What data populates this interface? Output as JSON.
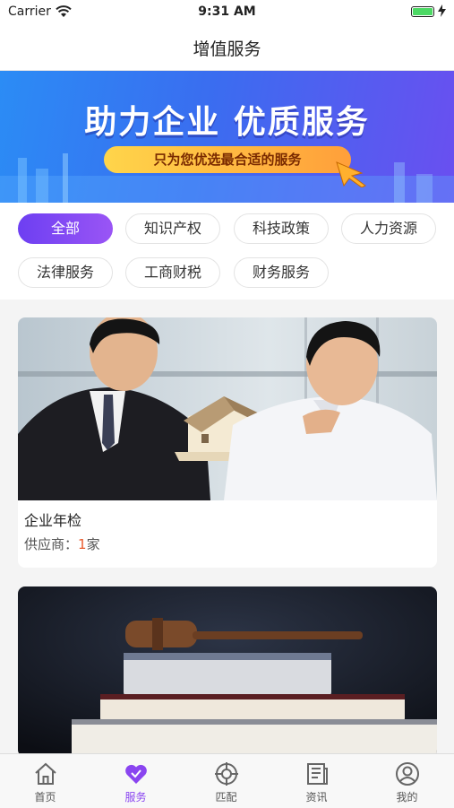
{
  "status_bar": {
    "carrier": "Carrier",
    "time": "9:31 AM"
  },
  "nav": {
    "title": "增值服务"
  },
  "banner": {
    "headline": "助力企业 优质服务",
    "subline": "只为您优选最合适的服务"
  },
  "filters": [
    {
      "label": "全部",
      "active": true
    },
    {
      "label": "知识产权"
    },
    {
      "label": "科技政策"
    },
    {
      "label": "人力资源"
    },
    {
      "label": "法律服务"
    },
    {
      "label": "工商财税"
    },
    {
      "label": "财务服务"
    }
  ],
  "cards": [
    {
      "title": "企业年检",
      "supplier_label": "供应商：",
      "supplier_count": "1",
      "supplier_unit": "家"
    },
    {
      "title": "",
      "supplier_label": "",
      "supplier_count": "",
      "supplier_unit": ""
    }
  ],
  "tabs": [
    {
      "label": "首页",
      "icon": "home-icon"
    },
    {
      "label": "服务",
      "icon": "heart-icon",
      "active": true
    },
    {
      "label": "匹配",
      "icon": "target-icon"
    },
    {
      "label": "资讯",
      "icon": "news-icon"
    },
    {
      "label": "我的",
      "icon": "user-icon"
    }
  ],
  "colors": {
    "accent": "#8a45f0",
    "supplier_count": "#e85a2b",
    "banner_start": "#2b8cf5",
    "banner_end": "#6a4ff0"
  }
}
